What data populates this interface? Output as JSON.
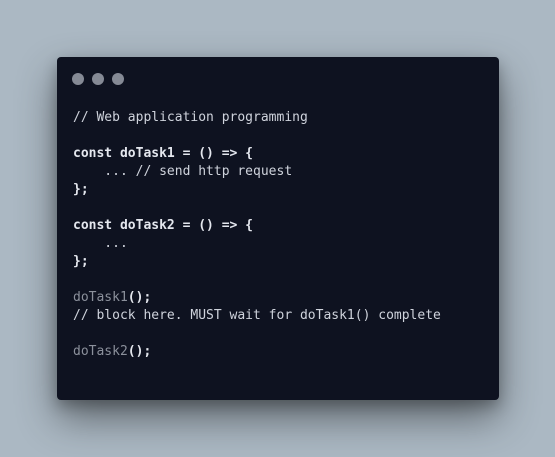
{
  "window": {
    "colors": {
      "background": "#abb8c3",
      "window": "#0e1220",
      "window_dots": "#858a95",
      "code_text": "#d6dae3",
      "muted_text": "#8b909b"
    },
    "controls": [
      "window-dot-1",
      "window-dot-2",
      "window-dot-3"
    ]
  },
  "code": {
    "line_1": "// Web application programming",
    "line_2": "",
    "line_3": "const doTask1 = () => {",
    "line_4": "    ... // send http request",
    "line_5": "};",
    "line_6": "",
    "line_7": "const doTask2 = () => {",
    "line_8": "    ...",
    "line_9": "};",
    "line_10": "",
    "line_11a": "doTask1",
    "line_11b": "();",
    "line_12": "// block here. MUST wait for doTask1() complete",
    "line_13": "",
    "line_14a": "doTask2",
    "line_14b": "();"
  }
}
